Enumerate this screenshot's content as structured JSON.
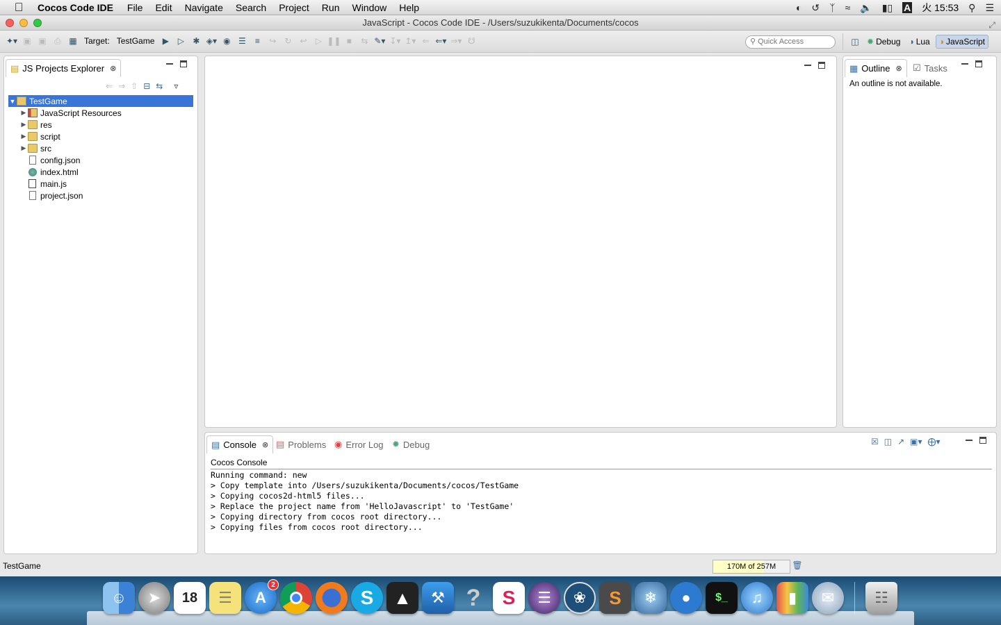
{
  "menubar": {
    "app_name": "Cocos Code IDE",
    "menus": [
      "File",
      "Edit",
      "Navigate",
      "Search",
      "Project",
      "Run",
      "Window",
      "Help"
    ],
    "clock": "火 15:53",
    "input_indicator": "A"
  },
  "window": {
    "title": "JavaScript - Cocos Code IDE - /Users/suzukikenta/Documents/cocos"
  },
  "toolbar": {
    "target_label": "Target:",
    "target_value": "TestGame",
    "quick_access_placeholder": "Quick Access",
    "perspectives": [
      "Debug",
      "Lua",
      "JavaScript"
    ],
    "active_perspective": "JavaScript"
  },
  "explorer": {
    "tab_label": "JS Projects Explorer",
    "tree": [
      {
        "label": "TestGame",
        "type": "project",
        "expanded": true,
        "selected": true
      },
      {
        "label": "JavaScript Resources",
        "type": "library"
      },
      {
        "label": "res",
        "type": "folder"
      },
      {
        "label": "script",
        "type": "folder"
      },
      {
        "label": "src",
        "type": "folder"
      },
      {
        "label": "config.json",
        "type": "file"
      },
      {
        "label": "index.html",
        "type": "html"
      },
      {
        "label": "main.js",
        "type": "js"
      },
      {
        "label": "project.json",
        "type": "file"
      }
    ]
  },
  "outline": {
    "tab_label": "Outline",
    "tasks_label": "Tasks",
    "message": "An outline is not available."
  },
  "console": {
    "tabs": [
      "Console",
      "Problems",
      "Error Log",
      "Debug"
    ],
    "title": "Cocos Console",
    "lines": [
      "Running command: new",
      "> Copy template into /Users/suzukikenta/Documents/cocos/TestGame",
      "> Copying cocos2d-html5 files...",
      "> Replace the project name from 'HelloJavascript' to 'TestGame'",
      "> Copying directory from cocos root directory...",
      "> Copying files from cocos root directory..."
    ]
  },
  "status": {
    "selection": "TestGame",
    "heap": "170M of 257M",
    "heap_used_fraction": 0.66
  },
  "dock": {
    "calendar_day": "18",
    "appstore_badge": "2",
    "apps": [
      "finder",
      "launchpad",
      "calendar",
      "stickies",
      "app-store",
      "chrome",
      "firefox",
      "skype",
      "unity",
      "xcode",
      "help",
      "slack",
      "eclipse",
      "sourcetree",
      "sublime-text",
      "cocos",
      "paw",
      "terminal",
      "itunes",
      "keynote",
      "preview",
      "trash"
    ]
  }
}
